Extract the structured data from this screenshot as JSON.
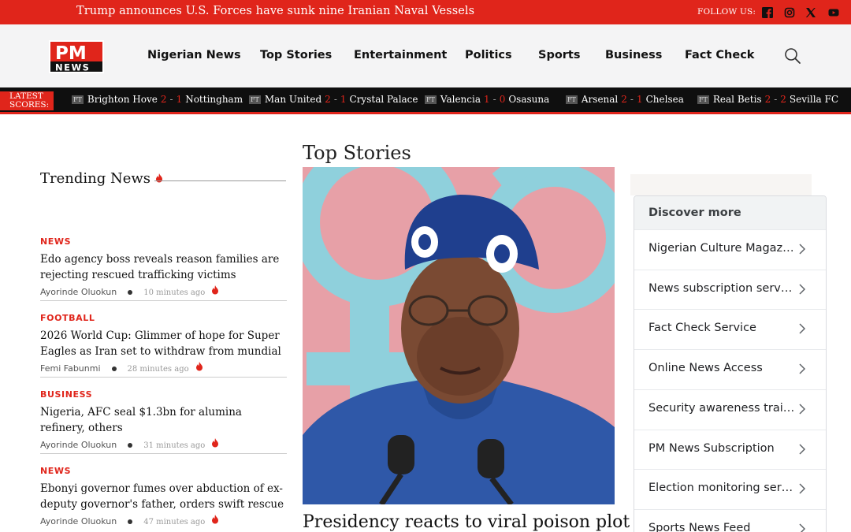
{
  "topbar": {
    "headline": "Trump announces U.S. Forces have sunk nine Iranian Naval Vessels",
    "follow_label": "FOLLOW US:",
    "social": [
      "facebook-icon",
      "instagram-icon",
      "x-icon",
      "youtube-icon"
    ]
  },
  "header": {
    "logo_text_top": "PM",
    "logo_text_bottom": "NEWS",
    "nav": [
      "Nigerian News",
      "Top Stories",
      "Entertainment",
      "Politics",
      "Sports",
      "Business",
      "Fact Check"
    ]
  },
  "scores": {
    "label": "LATEST SCORES:",
    "matches": [
      {
        "status": "FT",
        "home": "Brighton Hove",
        "home_score": "2",
        "away_score": "1",
        "away": "Nottingham"
      },
      {
        "status": "FT",
        "home": "Man United",
        "home_score": "2",
        "away_score": "1",
        "away": "Crystal Palace"
      },
      {
        "status": "FT",
        "home": "Valencia",
        "home_score": "1",
        "away_score": "0",
        "away": "Osasuna"
      },
      {
        "status": "FT",
        "home": "Arsenal",
        "home_score": "2",
        "away_score": "1",
        "away": "Chelsea"
      },
      {
        "status": "FT",
        "home": "Real Betis",
        "home_score": "2",
        "away_score": "2",
        "away": "Sevilla FC"
      }
    ]
  },
  "trending": {
    "title": "Trending News",
    "items": [
      {
        "category": "NEWS",
        "title": "Edo agency boss reveals reason families are rejecting rescued trafficking victims",
        "author": "Ayorinde Oluokun",
        "time": "10 minutes ago"
      },
      {
        "category": "FOOTBALL",
        "title": "2026 World Cup: Glimmer of hope for Super Eagles as Iran set to withdraw from mundial",
        "author": "Femi Fabunmi",
        "time": "28 minutes ago"
      },
      {
        "category": "BUSINESS",
        "title": "Nigeria, AFC seal $1.3bn for alumina refinery, others",
        "author": "Ayorinde Oluokun",
        "time": "31 minutes ago"
      },
      {
        "category": "NEWS",
        "title": "Ebonyi governor fumes over abduction of ex-deputy governor's father, orders swift rescue",
        "author": "Ayorinde Oluokun",
        "time": "47 minutes ago"
      }
    ]
  },
  "top_stories": {
    "title": "Top Stories",
    "lead_headline": "Presidency reacts to viral poison plot"
  },
  "discover": {
    "title": "Discover more",
    "items": [
      "Nigerian Culture Magazines",
      "News subscription services",
      "Fact Check Service",
      "Online News Access",
      "Security awareness training",
      "PM News Subscription",
      "Election monitoring services",
      "Sports News Feed"
    ]
  },
  "colors": {
    "brand_red": "#e0251b",
    "scores_bg": "#0f0f0f",
    "header_bg": "#f4f4f5"
  }
}
